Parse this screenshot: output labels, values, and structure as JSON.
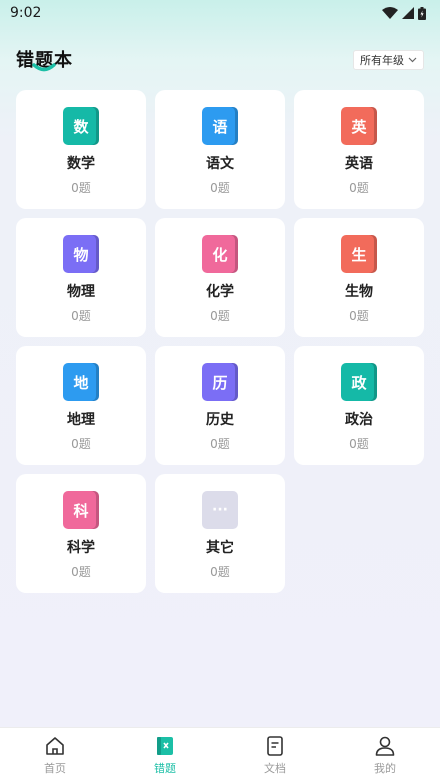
{
  "status": {
    "time": "9:02"
  },
  "header": {
    "title": "错题本",
    "grade_select": "所有年级"
  },
  "subjects": [
    {
      "icon": "数",
      "name": "数学",
      "count": "0题",
      "color": "#15b9a7"
    },
    {
      "icon": "语",
      "name": "语文",
      "count": "0题",
      "color": "#2d9bf0"
    },
    {
      "icon": "英",
      "name": "英语",
      "count": "0题",
      "color": "#f26b5b"
    },
    {
      "icon": "物",
      "name": "物理",
      "count": "0题",
      "color": "#7b6ef5"
    },
    {
      "icon": "化",
      "name": "化学",
      "count": "0题",
      "color": "#f0699b"
    },
    {
      "icon": "生",
      "name": "生物",
      "count": "0题",
      "color": "#f26b5b"
    },
    {
      "icon": "地",
      "name": "地理",
      "count": "0题",
      "color": "#2d9bf0"
    },
    {
      "icon": "历",
      "name": "历史",
      "count": "0题",
      "color": "#7b6ef5"
    },
    {
      "icon": "政",
      "name": "政治",
      "count": "0题",
      "color": "#15b9a7"
    },
    {
      "icon": "科",
      "name": "科学",
      "count": "0题",
      "color": "#f0699b"
    },
    {
      "icon": "···",
      "name": "其它",
      "count": "0题",
      "color": "#dcdcea"
    }
  ],
  "tabs": [
    {
      "label": "首页",
      "icon": "home-icon"
    },
    {
      "label": "错题",
      "icon": "wrongbook-icon"
    },
    {
      "label": "文档",
      "icon": "document-icon"
    },
    {
      "label": "我的",
      "icon": "user-icon"
    }
  ],
  "colors": {
    "accent": "#1bbfa6",
    "tab_inactive": "#9a9a9a"
  }
}
